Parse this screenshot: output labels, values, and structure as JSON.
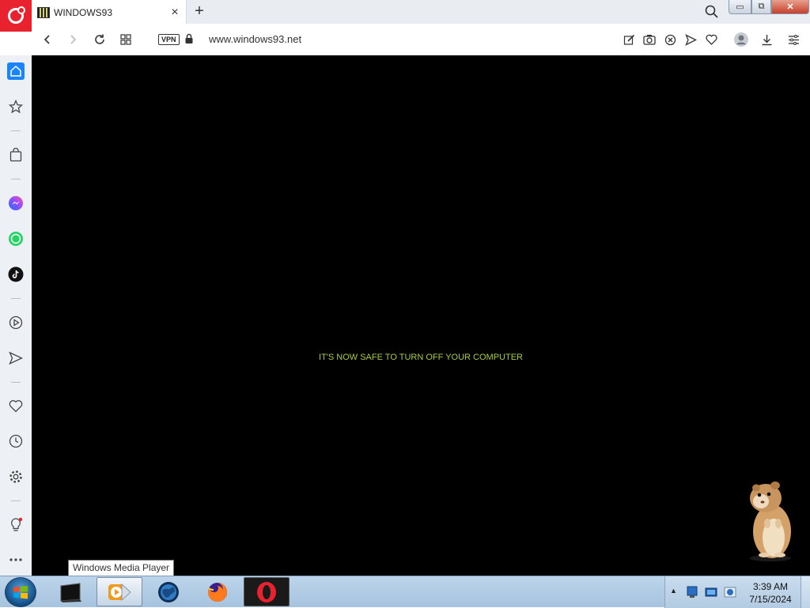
{
  "browser": {
    "tab": {
      "title": "WINDOWS93",
      "favicon": "windows93-favicon-icon",
      "close": "×"
    },
    "new_tab": "+",
    "address": {
      "vpn_label": "VPN",
      "url": "www.windows93.net"
    },
    "icons": {
      "back": "back-icon",
      "forward": "forward-icon",
      "reload": "reload-icon",
      "tabs": "tabs-grid-icon",
      "lock": "lock-icon",
      "edit": "edit-icon",
      "snapshot": "camera-icon",
      "adblock": "adblock-icon",
      "send": "send-icon",
      "heart": "heart-icon",
      "profile": "profile-icon",
      "download": "download-icon",
      "easy_setup": "easy-setup-icon",
      "search": "search-icon"
    },
    "window_buttons": {
      "minimize": "▭",
      "maximize": "⧉",
      "close": "✕"
    },
    "accent": "#e8232f"
  },
  "sidebar": {
    "items": [
      "home-icon",
      "star-icon",
      "bag-icon",
      "messenger-icon",
      "whatsapp-icon",
      "tiktok-icon",
      "player-icon",
      "send-icon",
      "heart-icon",
      "history-icon",
      "settings-icon",
      "lightbulb-icon",
      "more-icon"
    ]
  },
  "page": {
    "message": "IT'S NOW SAFE TO TURN OFF YOUR COMPUTER",
    "message_color": "#a8cc3c",
    "background": "#000000"
  },
  "taskbar": {
    "tooltip": "Windows Media Player",
    "apps": [
      "terminal-icon",
      "windows-media-player-icon",
      "globe-icon",
      "firefox-icon",
      "opera-icon"
    ],
    "clock": {
      "time": "3:39 AM",
      "date": "7/15/2024"
    },
    "tray_chevron": "▲"
  }
}
